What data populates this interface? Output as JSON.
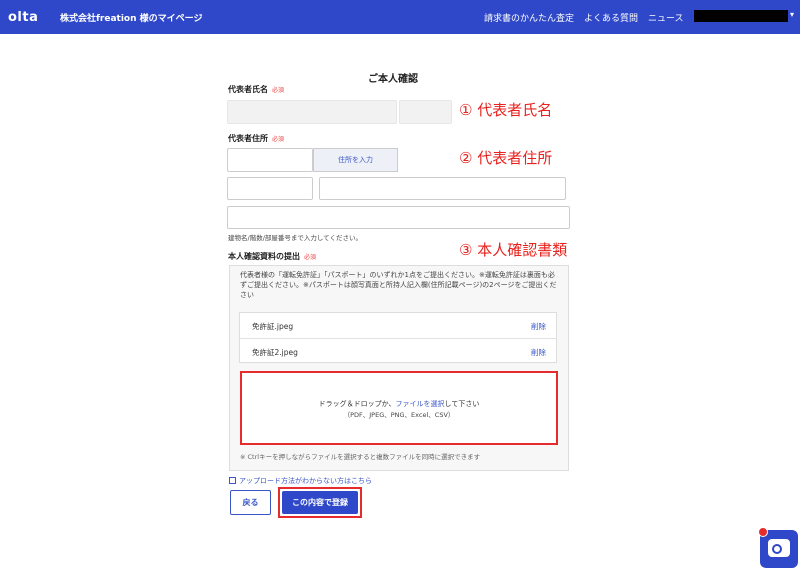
{
  "header": {
    "logo": "olta",
    "title": "株式会社freation 様のマイページ",
    "nav": [
      "請求書のかんたん査定",
      "よくある質問",
      "ニュース"
    ],
    "user_caret": "▾"
  },
  "page_title": "ご本人確認",
  "rep_name": {
    "label": "代表者氏名",
    "required": "必須"
  },
  "rep_address": {
    "label": "代表者住所",
    "required": "必須",
    "address_button": "住所を入力",
    "building_hint": "建物名/階数/部屋番号まで入力してください。"
  },
  "identity_docs": {
    "label": "本人確認資料の提出",
    "required": "必須",
    "note": "代表者様の「運転免許証」「パスポート」のいずれか1点をご提出ください。※運転免許証は裏面も必ずご提出ください。※パスポートは顔写真面と所持人記入欄(住所記載ページ)の2ページをご提出ください",
    "files": [
      {
        "name": "免許証.jpeg",
        "delete": "削除"
      },
      {
        "name": "免許証2.jpeg",
        "delete": "削除"
      }
    ],
    "dropzone": {
      "prefix": "ドラッグ＆ドロップか、",
      "link": "ファイルを選択",
      "suffix": "して下さい",
      "formats": "（PDF、JPEG、PNG、Excel、CSV）"
    },
    "ctrl_hint": "※ Ctrlキーを押しながらファイルを選択すると複数ファイルを同時に選択できます"
  },
  "annotations": {
    "one": "① 代表者氏名",
    "two": "② 代表者住所",
    "three": "③ 本人確認書類"
  },
  "help_link": "アップロード方法がわからない方はこちら",
  "buttons": {
    "back": "戻る",
    "submit": "この内容で登録"
  },
  "colors": {
    "brand": "#2e48c9",
    "highlight": "#e52b2b",
    "link": "#3a56c8"
  },
  "icons": {
    "chat": "chat-bubble-icon",
    "help": "document-icon"
  }
}
